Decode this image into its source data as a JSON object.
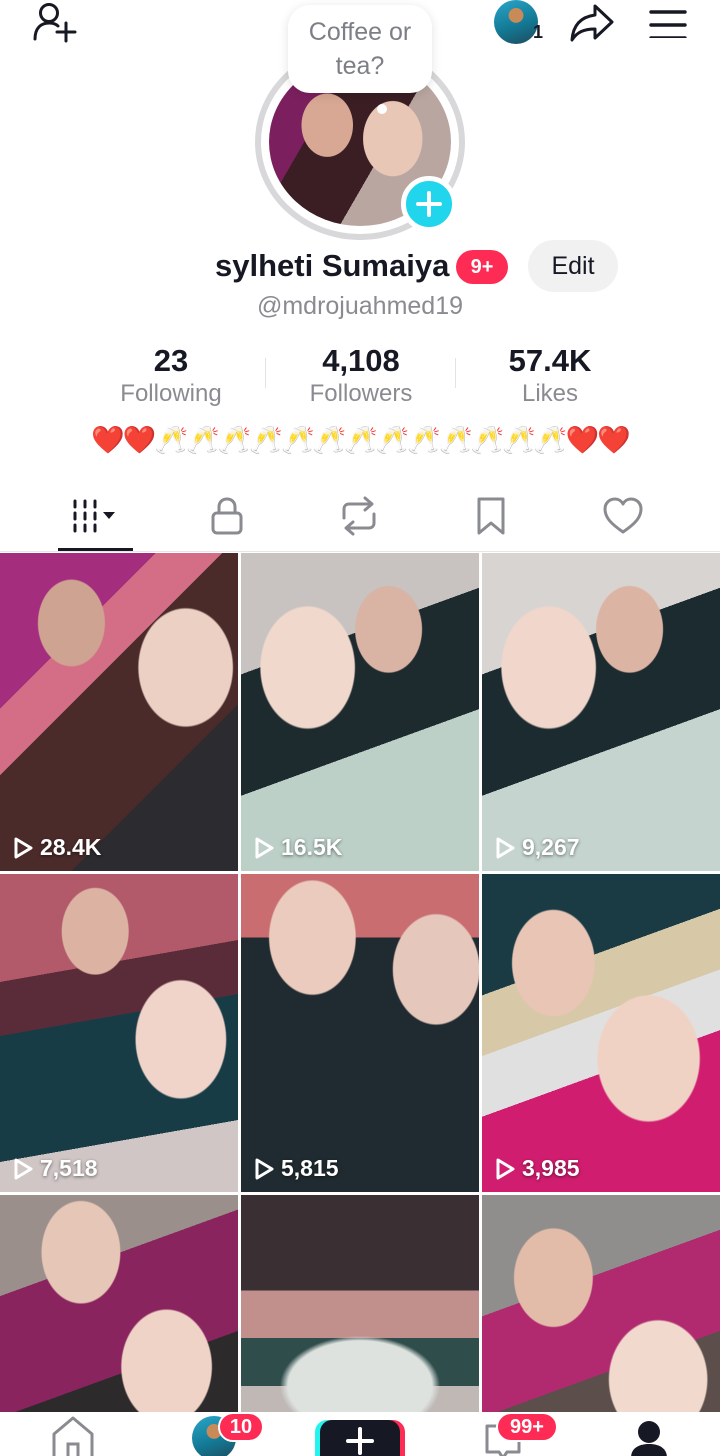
{
  "header": {
    "add_user_icon": "add-user-icon",
    "share_icon": "share-icon",
    "menu_icon": "hamburger-menu-icon",
    "story_count": "1"
  },
  "profile": {
    "note_bubble": "Coffee or tea?",
    "display_name": "sylheti Sumaiya",
    "badge": "9+",
    "edit_label": "Edit",
    "handle": "@mdrojuahmed19",
    "bio": "❤️❤️🥂🥂🥂🥂🥂🥂🥂🥂🥂🥂🥂🥂🥂❤️❤️"
  },
  "stats": [
    {
      "value": "23",
      "label": "Following"
    },
    {
      "value": "4,108",
      "label": "Followers"
    },
    {
      "value": "57.4K",
      "label": "Likes"
    }
  ],
  "tabs": [
    {
      "name": "videos",
      "icon": "grid-videos-icon",
      "active": true
    },
    {
      "name": "private",
      "icon": "lock-icon"
    },
    {
      "name": "reposts",
      "icon": "repost-icon"
    },
    {
      "name": "favorites",
      "icon": "bookmark-icon"
    },
    {
      "name": "liked",
      "icon": "heart-icon"
    }
  ],
  "videos": [
    {
      "views": "28.4K"
    },
    {
      "views": "16.5K"
    },
    {
      "views": "9,267"
    },
    {
      "views": "7,518"
    },
    {
      "views": "5,815"
    },
    {
      "views": "3,985"
    },
    {
      "views": ""
    },
    {
      "views": ""
    },
    {
      "views": ""
    }
  ],
  "bottom_nav": {
    "friends_badge": "10",
    "inbox_badge": "99+"
  },
  "colors": {
    "accent_pink": "#fe2c55",
    "accent_cyan": "#20d5ec",
    "text_primary": "#161823",
    "text_secondary": "#8a8b91"
  }
}
